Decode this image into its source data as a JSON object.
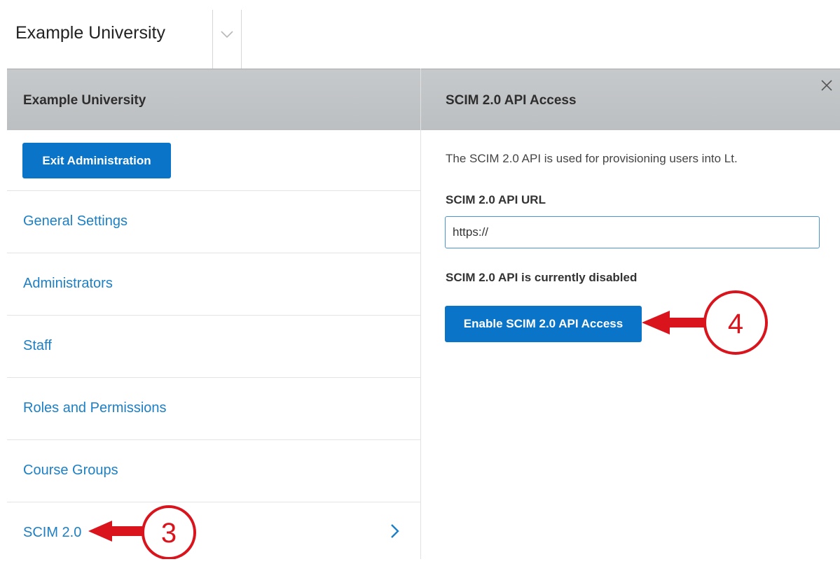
{
  "topbar": {
    "org_title": "Example University"
  },
  "left_panel": {
    "header": "Example University",
    "exit_button": "Exit Administration",
    "nav_items": [
      "General Settings",
      "Administrators",
      "Staff",
      "Roles and Permissions",
      "Course Groups",
      "SCIM 2.0"
    ]
  },
  "right_panel": {
    "header": "SCIM 2.0 API Access",
    "description": "The SCIM 2.0 API is used for provisioning users into Lt.",
    "url_label": "SCIM 2.0 API URL",
    "url_value": "https://",
    "status": "SCIM 2.0 API is currently disabled",
    "enable_button": "Enable SCIM 2.0 API Access"
  },
  "annotations": {
    "step_a": "3",
    "step_b": "4"
  },
  "colors": {
    "accent": "#0a74c9",
    "link": "#1d7fc4",
    "annotation": "#d9141d",
    "header_bg": "#c1c4c6"
  },
  "icons": {
    "dropdown": "chevron-down-icon",
    "close": "close-icon",
    "active_item": "chevron-right-icon"
  }
}
